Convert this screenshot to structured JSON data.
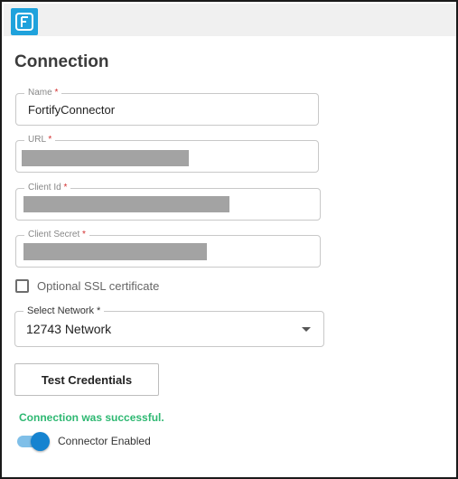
{
  "app": {
    "logo_icon": "app-logo-icon",
    "accent_color": "#1fa2dc"
  },
  "page": {
    "title": "Connection"
  },
  "form": {
    "name": {
      "label": "Name",
      "required_mark": "*",
      "value": "FortifyConnector"
    },
    "url": {
      "label": "URL",
      "required_mark": "*",
      "value_redacted": true
    },
    "client_id": {
      "label": "Client Id",
      "required_mark": "*",
      "value_redacted": true
    },
    "client_secret": {
      "label": "Client Secret",
      "required_mark": "*",
      "value_redacted": true
    },
    "ssl": {
      "label": "Optional SSL certificate",
      "checked": false
    },
    "network": {
      "label": "Select Network",
      "required_mark": "*",
      "value": "12743 Network",
      "icon": "chevron-down-icon"
    }
  },
  "actions": {
    "test_credentials_label": "Test Credentials"
  },
  "status": {
    "message": "Connection was successful.",
    "color": "#2eb872"
  },
  "connector": {
    "label": "Connector Enabled",
    "enabled": true,
    "toggle_color": "#1583d0"
  }
}
